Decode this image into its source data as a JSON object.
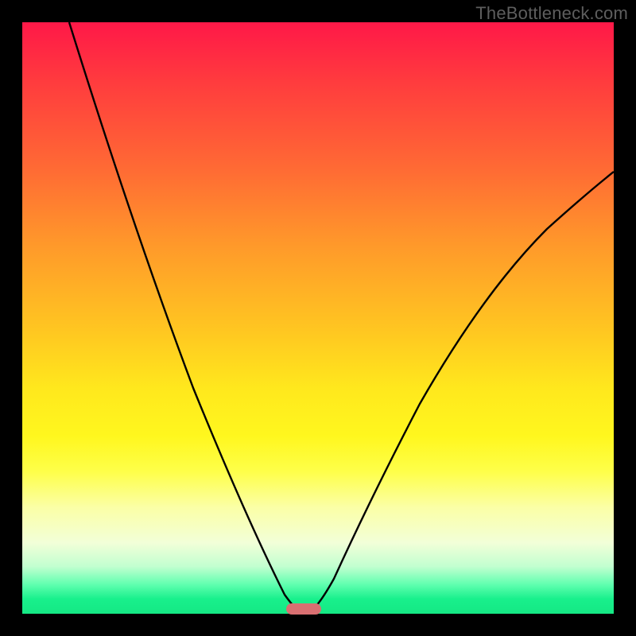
{
  "watermark": "TheBottleneck.com",
  "colors": {
    "frame": "#000000",
    "curve": "#000000",
    "marker": "#d96f71",
    "gradient_top": "#ff1848",
    "gradient_bottom": "#15e884"
  },
  "chart_data": {
    "type": "line",
    "title": "",
    "xlabel": "",
    "ylabel": "",
    "xlim": [
      0,
      100
    ],
    "ylim": [
      0,
      100
    ],
    "grid": false,
    "legend": false,
    "annotations": [
      "TheBottleneck.com"
    ],
    "optimum_marker": {
      "x_center": 47.5,
      "x_width": 6,
      "y": 0
    },
    "series": [
      {
        "name": "left-branch",
        "x": [
          8,
          12,
          16,
          20,
          24,
          28,
          32,
          36,
          40,
          44,
          47
        ],
        "values": [
          100,
          84,
          70,
          57,
          45,
          35,
          26,
          18,
          11,
          5,
          1
        ]
      },
      {
        "name": "right-branch",
        "x": [
          49,
          52,
          56,
          60,
          64,
          68,
          72,
          76,
          80,
          84,
          88,
          92,
          96,
          100
        ],
        "values": [
          1,
          6,
          13,
          21,
          28,
          35,
          42,
          48,
          54,
          59,
          64,
          68,
          72,
          75
        ]
      }
    ]
  }
}
